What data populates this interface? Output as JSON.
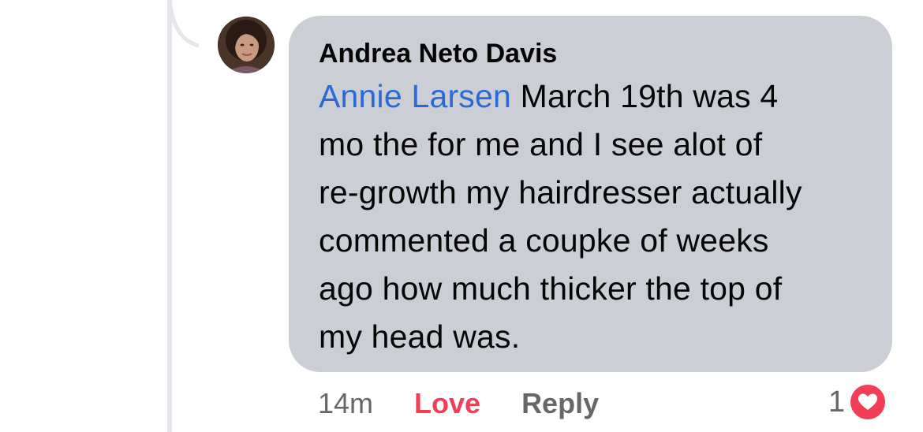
{
  "comment": {
    "author": "Andrea Neto Davis",
    "mention": "Annie Larsen",
    "lines": [
      " March 19th was 4",
      "mo the for me and I see alot of",
      "re-growth my hairdresser actually",
      "commented a coupke of weeks",
      "ago how much thicker the top of",
      "my head was."
    ]
  },
  "actions": {
    "time": "14m",
    "love_label": "Love",
    "reply_label": "Reply"
  },
  "reactions": {
    "count": "1",
    "icon": "love-reaction-icon"
  },
  "colors": {
    "bubble": "#ccced6",
    "mention": "#2a6ad6",
    "love": "#f33e58",
    "secondary_text": "#65676b"
  }
}
